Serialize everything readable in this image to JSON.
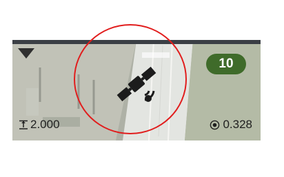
{
  "status_panel": {
    "satellite_count": "10",
    "height_value": "2.000",
    "accuracy_value": "0.328",
    "icons": {
      "dropdown": "triangle-down-icon",
      "satellite": "satellite-icon",
      "height": "antenna-height-icon",
      "accuracy": "target-icon"
    },
    "colors": {
      "badge": "#3f6b2a",
      "highlight": "#e11d1d"
    }
  }
}
